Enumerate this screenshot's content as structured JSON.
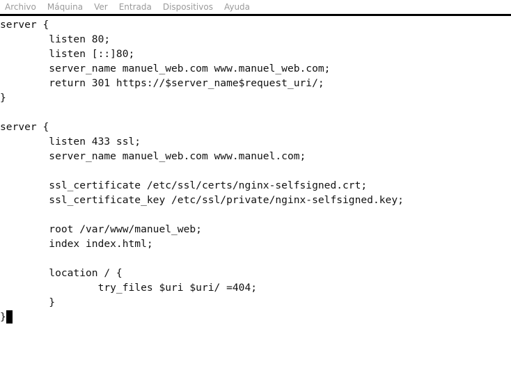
{
  "menubar": {
    "items": [
      "Archivo",
      "Máquina",
      "Ver",
      "Entrada",
      "Dispositivos",
      "Ayuda"
    ]
  },
  "editor": {
    "lines": [
      "server {",
      "        listen 80;",
      "        listen [::]80;",
      "        server_name manuel_web.com www.manuel_web.com;",
      "        return 301 https://$server_name$request_uri/;",
      "}",
      "",
      "server {",
      "        listen 433 ssl;",
      "        server_name manuel_web.com www.manuel.com;",
      "",
      "        ssl_certificate /etc/ssl/certs/nginx-selfsigned.crt;",
      "        ssl_certificate_key /etc/ssl/private/nginx-selfsigned.key;",
      "",
      "        root /var/www/manuel_web;",
      "        index index.html;",
      "",
      "        location / {",
      "                try_files $uri $uri/ =404;",
      "        }",
      "}"
    ]
  }
}
